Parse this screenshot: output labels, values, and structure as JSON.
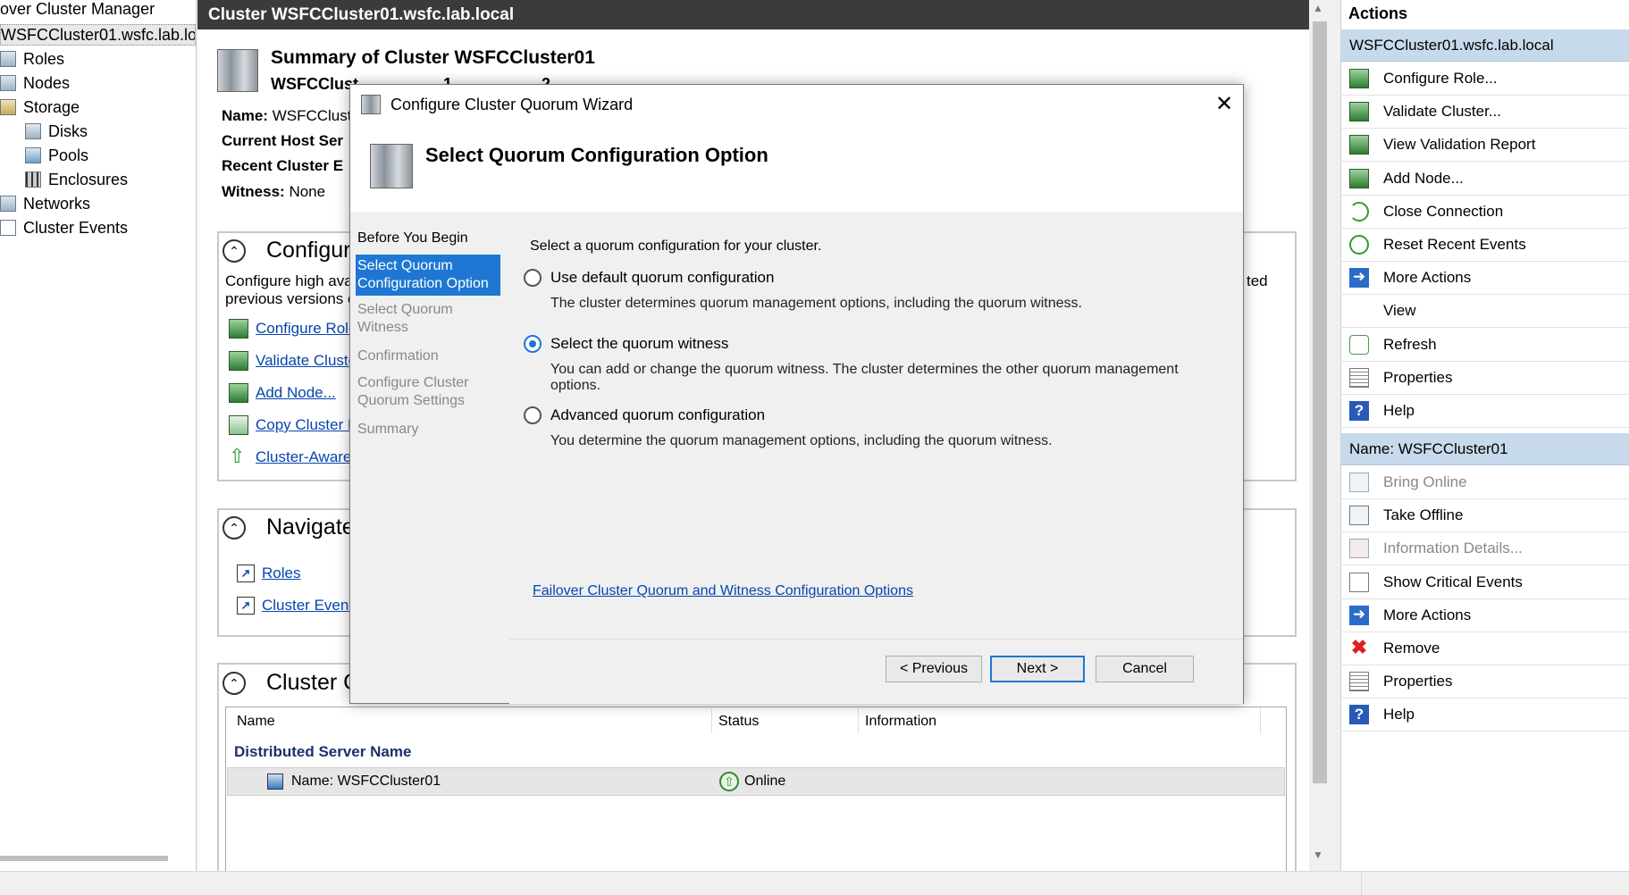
{
  "tree": {
    "root_title": "over Cluster Manager",
    "selected_node": "WSFCCluster01.wsfc.lab.loca",
    "items": [
      {
        "label": "Roles",
        "icon": "roles-icon"
      },
      {
        "label": "Nodes",
        "icon": "nodes-icon"
      },
      {
        "label": "Storage",
        "icon": "storage-icon"
      },
      {
        "label": "Disks",
        "icon": "disks-icon"
      },
      {
        "label": "Pools",
        "icon": "pools-icon"
      },
      {
        "label": "Enclosures",
        "icon": "enclosures-icon"
      },
      {
        "label": "Networks",
        "icon": "networks-icon"
      },
      {
        "label": "Cluster Events",
        "icon": "events-icon"
      }
    ]
  },
  "center": {
    "title": "Cluster WSFCCluster01.wsfc.lab.local",
    "summary_title": "Summary of Cluster WSFCCluster01",
    "summary_subtitle": "WSFCClust————— 1 ————— 2 ———",
    "name_label": "Name:",
    "name_value": "WSFCClust",
    "current_host_label": "Current Host Ser",
    "recent_events_label": "Recent Cluster E",
    "witness_label": "Witness:",
    "witness_value": "None",
    "configure": {
      "title": "Configure",
      "text_line1": "Configure high ava",
      "text_line2": "previous versions o",
      "text_right": "ted",
      "links": [
        "Configure Role",
        "Validate Cluste",
        "Add Node...",
        "Copy Cluster R",
        "Cluster-Aware U"
      ]
    },
    "navigate": {
      "title": "Navigate",
      "links": [
        "Roles",
        "Cluster Events"
      ]
    },
    "core": {
      "title": "Cluster C",
      "columns": [
        "Name",
        "Status",
        "Information"
      ],
      "group": "Distributed Server Name",
      "row": {
        "name": "Name: WSFCCluster01",
        "status": "Online",
        "information": ""
      }
    }
  },
  "actions": {
    "header": "Actions",
    "group1": "WSFCCluster01.wsfc.lab.local",
    "group1_items": [
      {
        "label": "Configure Role...",
        "icon": "configure-role-icon",
        "enabled": true
      },
      {
        "label": "Validate Cluster...",
        "icon": "validate-cluster-icon",
        "enabled": true
      },
      {
        "label": "View Validation Report",
        "icon": "validation-report-icon",
        "enabled": true
      },
      {
        "label": "Add Node...",
        "icon": "add-node-icon",
        "enabled": true
      },
      {
        "label": "Close Connection",
        "icon": "close-connection-icon",
        "enabled": true
      },
      {
        "label": "Reset Recent Events",
        "icon": "reset-events-icon",
        "enabled": true
      },
      {
        "label": "More Actions",
        "icon": "more-actions-icon",
        "enabled": true
      },
      {
        "label": "View",
        "icon": "",
        "enabled": true
      },
      {
        "label": "Refresh",
        "icon": "refresh-icon",
        "enabled": true
      },
      {
        "label": "Properties",
        "icon": "properties-icon",
        "enabled": true
      },
      {
        "label": "Help",
        "icon": "help-icon",
        "enabled": true
      }
    ],
    "group2": "Name: WSFCCluster01",
    "group2_items": [
      {
        "label": "Bring Online",
        "icon": "bring-online-icon",
        "enabled": false
      },
      {
        "label": "Take Offline",
        "icon": "take-offline-icon",
        "enabled": true
      },
      {
        "label": "Information Details...",
        "icon": "information-details-icon",
        "enabled": false
      },
      {
        "label": "Show Critical Events",
        "icon": "critical-events-icon",
        "enabled": true
      },
      {
        "label": "More Actions",
        "icon": "more-actions-icon",
        "enabled": true
      },
      {
        "label": "Remove",
        "icon": "remove-icon",
        "enabled": true
      },
      {
        "label": "Properties",
        "icon": "properties-icon",
        "enabled": true
      },
      {
        "label": "Help",
        "icon": "help-icon",
        "enabled": true
      }
    ]
  },
  "dialog": {
    "title": "Configure Cluster Quorum Wizard",
    "heading": "Select Quorum Configuration Option",
    "steps": [
      {
        "label": "Before You Begin",
        "state": "done"
      },
      {
        "label": "Select Quorum Configuration Option",
        "state": "current"
      },
      {
        "label": "Select Quorum Witness",
        "state": "pending"
      },
      {
        "label": "Confirmation",
        "state": "pending"
      },
      {
        "label": "Configure Cluster Quorum Settings",
        "state": "pending"
      },
      {
        "label": "Summary",
        "state": "pending"
      }
    ],
    "prompt": "Select a quorum configuration for your cluster.",
    "options": [
      {
        "label": "Use default quorum configuration",
        "description": "The cluster determines quorum management options, including the quorum witness.",
        "checked": false
      },
      {
        "label": "Select the quorum witness",
        "description": "You can add or change the quorum witness. The cluster determines the other quorum management options.",
        "checked": true
      },
      {
        "label": "Advanced quorum configuration",
        "description": "You determine the quorum management options, including the quorum witness.",
        "checked": false
      }
    ],
    "help_link": "Failover Cluster Quorum and Witness Configuration Options",
    "buttons": {
      "previous": "< Previous",
      "next": "Next >",
      "cancel": "Cancel"
    }
  },
  "colors": {
    "accent": "#1e77d3",
    "title_bar": "#3b3b3b",
    "action_group": "#c7daec",
    "link": "#0645ad"
  }
}
